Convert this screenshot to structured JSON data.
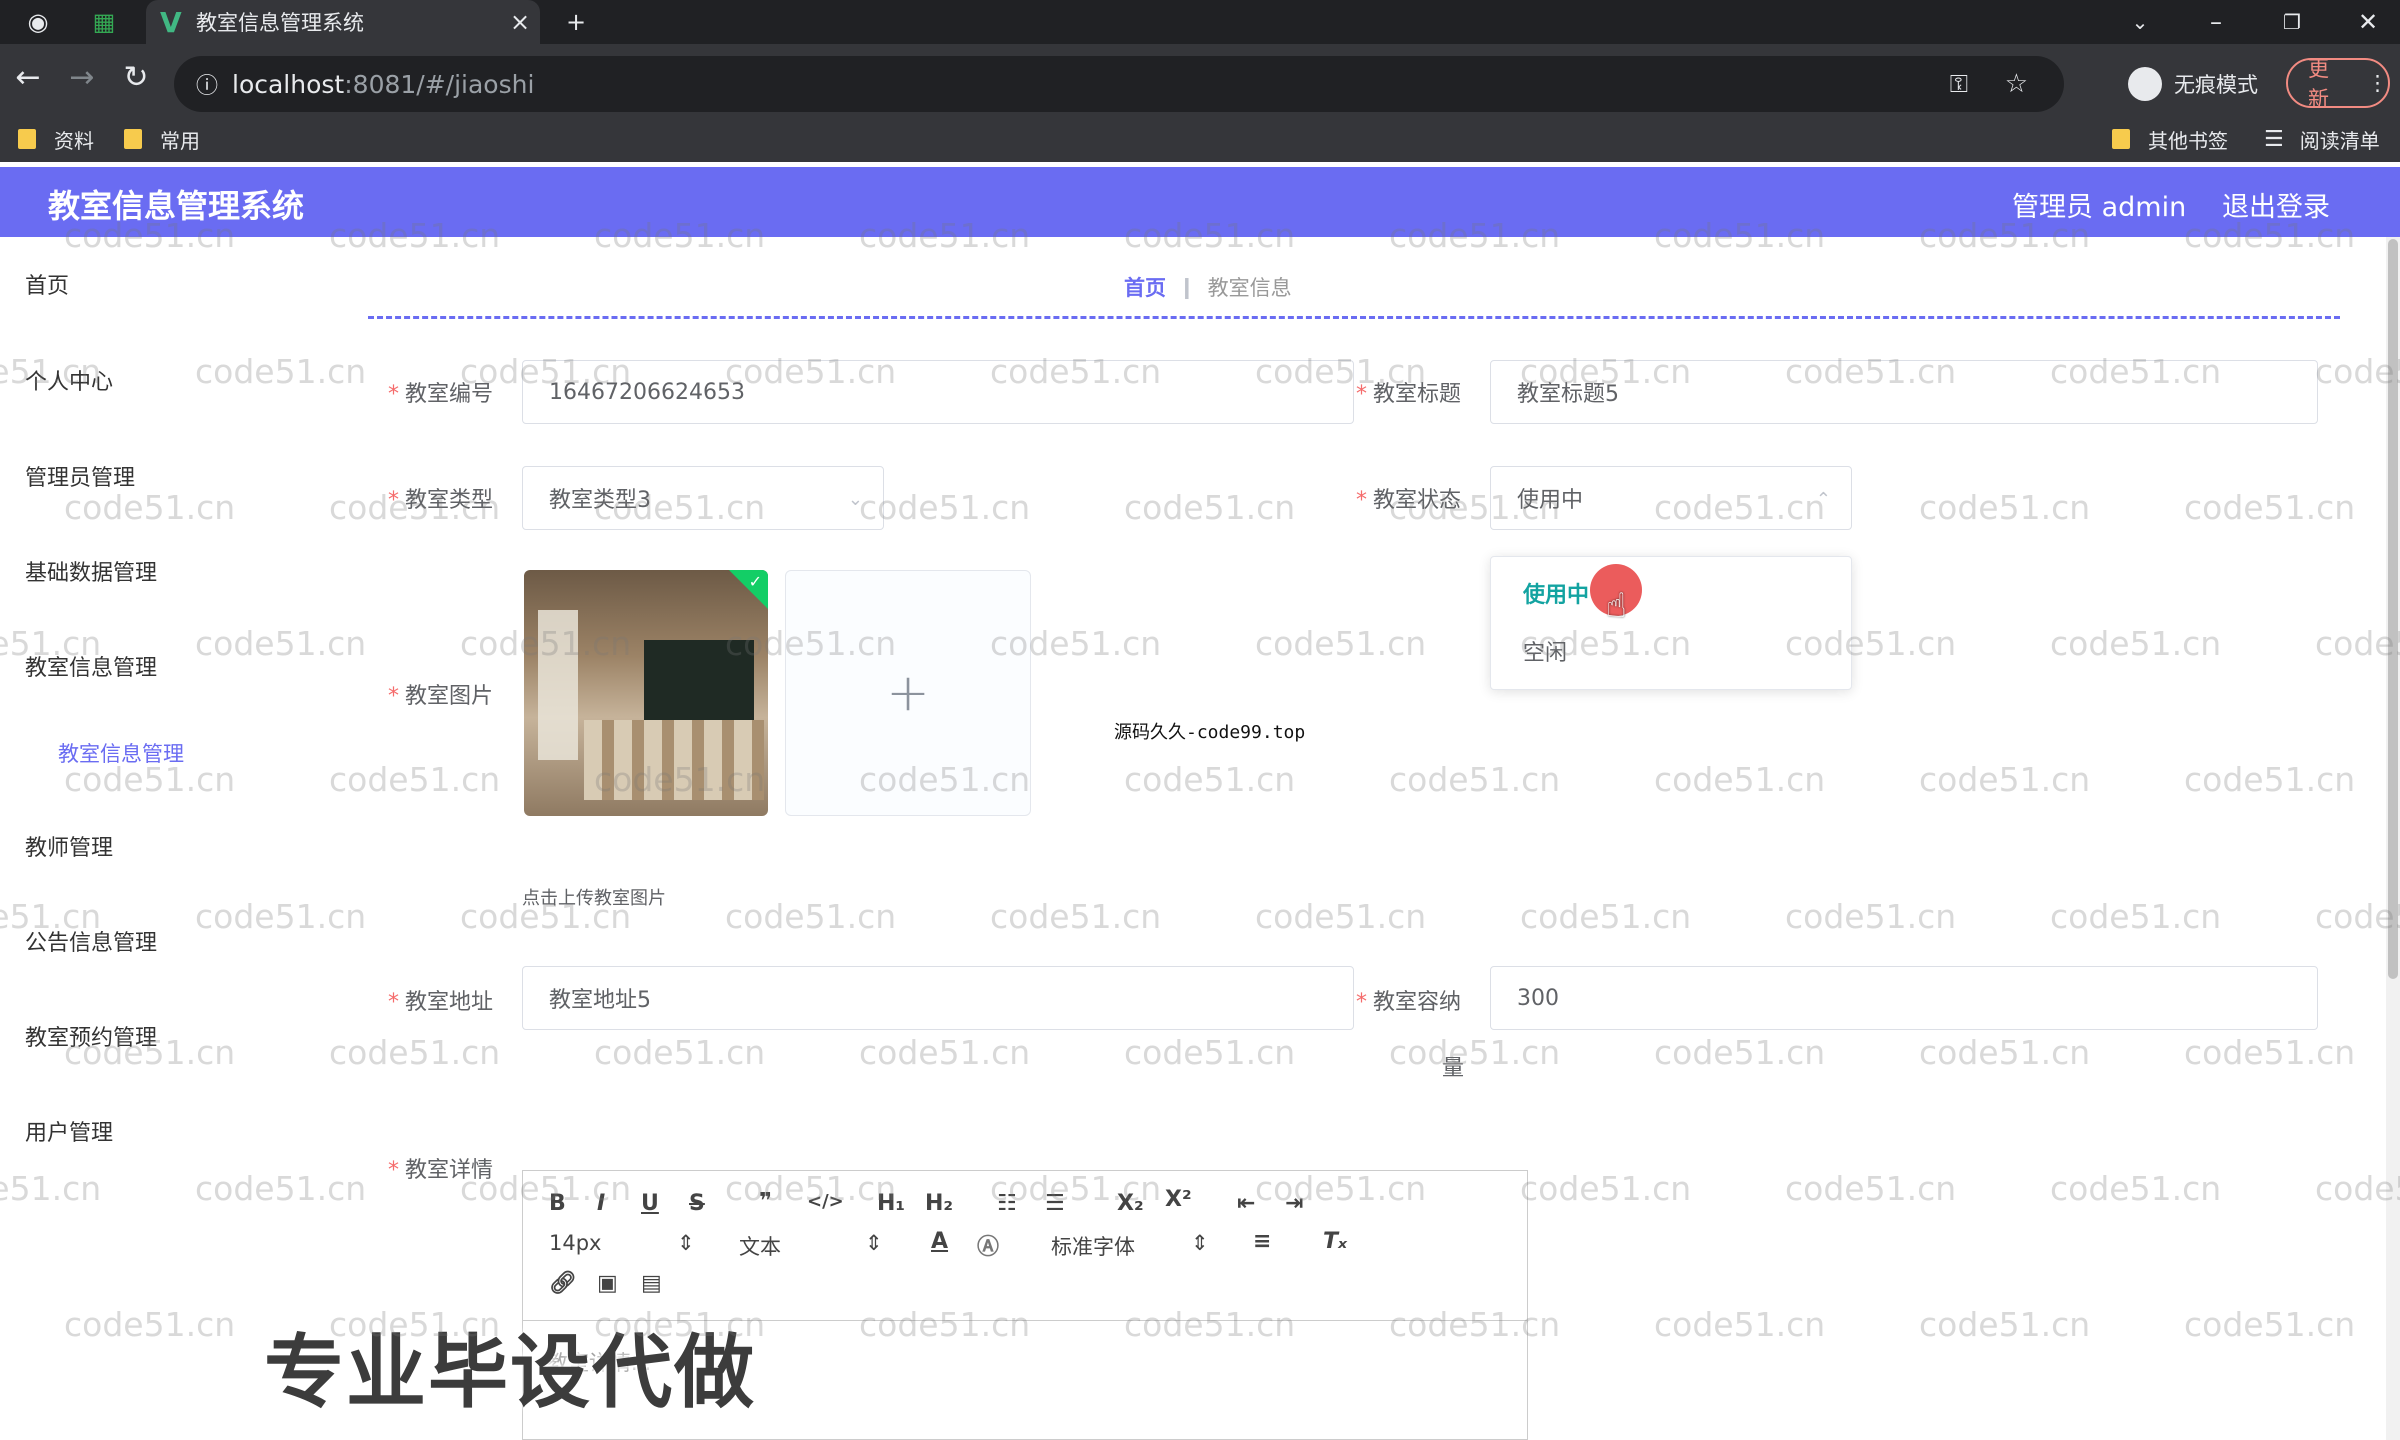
{
  "browser": {
    "tab_title": "教室信息管理系统",
    "tab_logo": "V",
    "tab_close": "×",
    "new_tab": "+",
    "url_host": "localhost",
    "url_rest": ":8081/#/jiaoshi",
    "incognito_label": "无痕模式",
    "update_label": "更新",
    "bookmarks": [
      "资料",
      "常用"
    ],
    "other_bookmarks": "其他书签",
    "reading_list": "阅读清单"
  },
  "app": {
    "title": "教室信息管理系统",
    "user": "管理员 admin",
    "logout": "退出登录"
  },
  "sidebar": {
    "items": [
      "首页",
      "个人中心",
      "管理员管理",
      "基础数据管理",
      "教室信息管理",
      "教师管理",
      "公告信息管理",
      "教室预约管理",
      "用户管理"
    ],
    "sub_item": "教室信息管理"
  },
  "breadcrumb": {
    "home": "首页",
    "current": "教室信息"
  },
  "form": {
    "required_mark": "*",
    "number_label": "教室编号",
    "number_value": "16467206624653",
    "title_label": "教室标题",
    "title_value": "教室标题5",
    "type_label": "教室类型",
    "type_value": "教室类型3",
    "status_label": "教室状态",
    "status_value": "使用中",
    "status_options": [
      "使用中",
      "空闲"
    ],
    "image_label": "教室图片",
    "upload_plus": "+",
    "upload_hint": "点击上传教室图片",
    "address_label": "教室地址",
    "address_value": "教室地址5",
    "capacity_label": "教室容纳",
    "capacity_label_wrap": "量",
    "capacity_value": "300",
    "detail_label": "教室详情",
    "detail_placeholder": "教室详情..."
  },
  "editor": {
    "font_size": "14px",
    "block": "文本",
    "font": "标准字体"
  },
  "overlay": {
    "source_tag": "源码久久-code99.top",
    "promo": "专业毕设代做",
    "watermark": "code51.cn"
  }
}
